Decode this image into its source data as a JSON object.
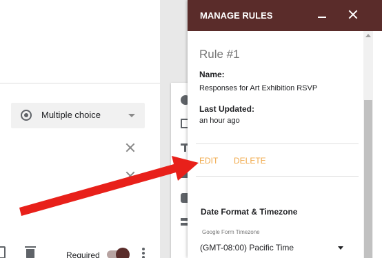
{
  "form": {
    "question_type": "Multiple choice",
    "required_label": "Required",
    "required_on": true
  },
  "panel": {
    "title": "MANAGE RULES",
    "rule_heading": "Rule #1",
    "name_label": "Name:",
    "name_value": "Responses for Art Exhibition RSVP",
    "updated_label": "Last Updated:",
    "updated_value": "an hour ago",
    "edit_label": "EDIT",
    "delete_label": "DELETE",
    "section_title": "Date Format & Timezone",
    "timezone_caption": "Google Form Timezone",
    "timezone_value": "(GMT-08:00) Pacific Time"
  },
  "colors": {
    "header": "#5a2c2a",
    "link": "#f0a94a",
    "annotation_arrow": "#e8201a"
  },
  "icons": [
    "close-icon",
    "minimize-icon",
    "radio-icon",
    "caret-down-icon",
    "copy-icon",
    "trash-icon",
    "kebab-icon",
    "add-question-icon",
    "import-icon",
    "title-icon",
    "image-icon",
    "video-icon",
    "section-icon"
  ]
}
